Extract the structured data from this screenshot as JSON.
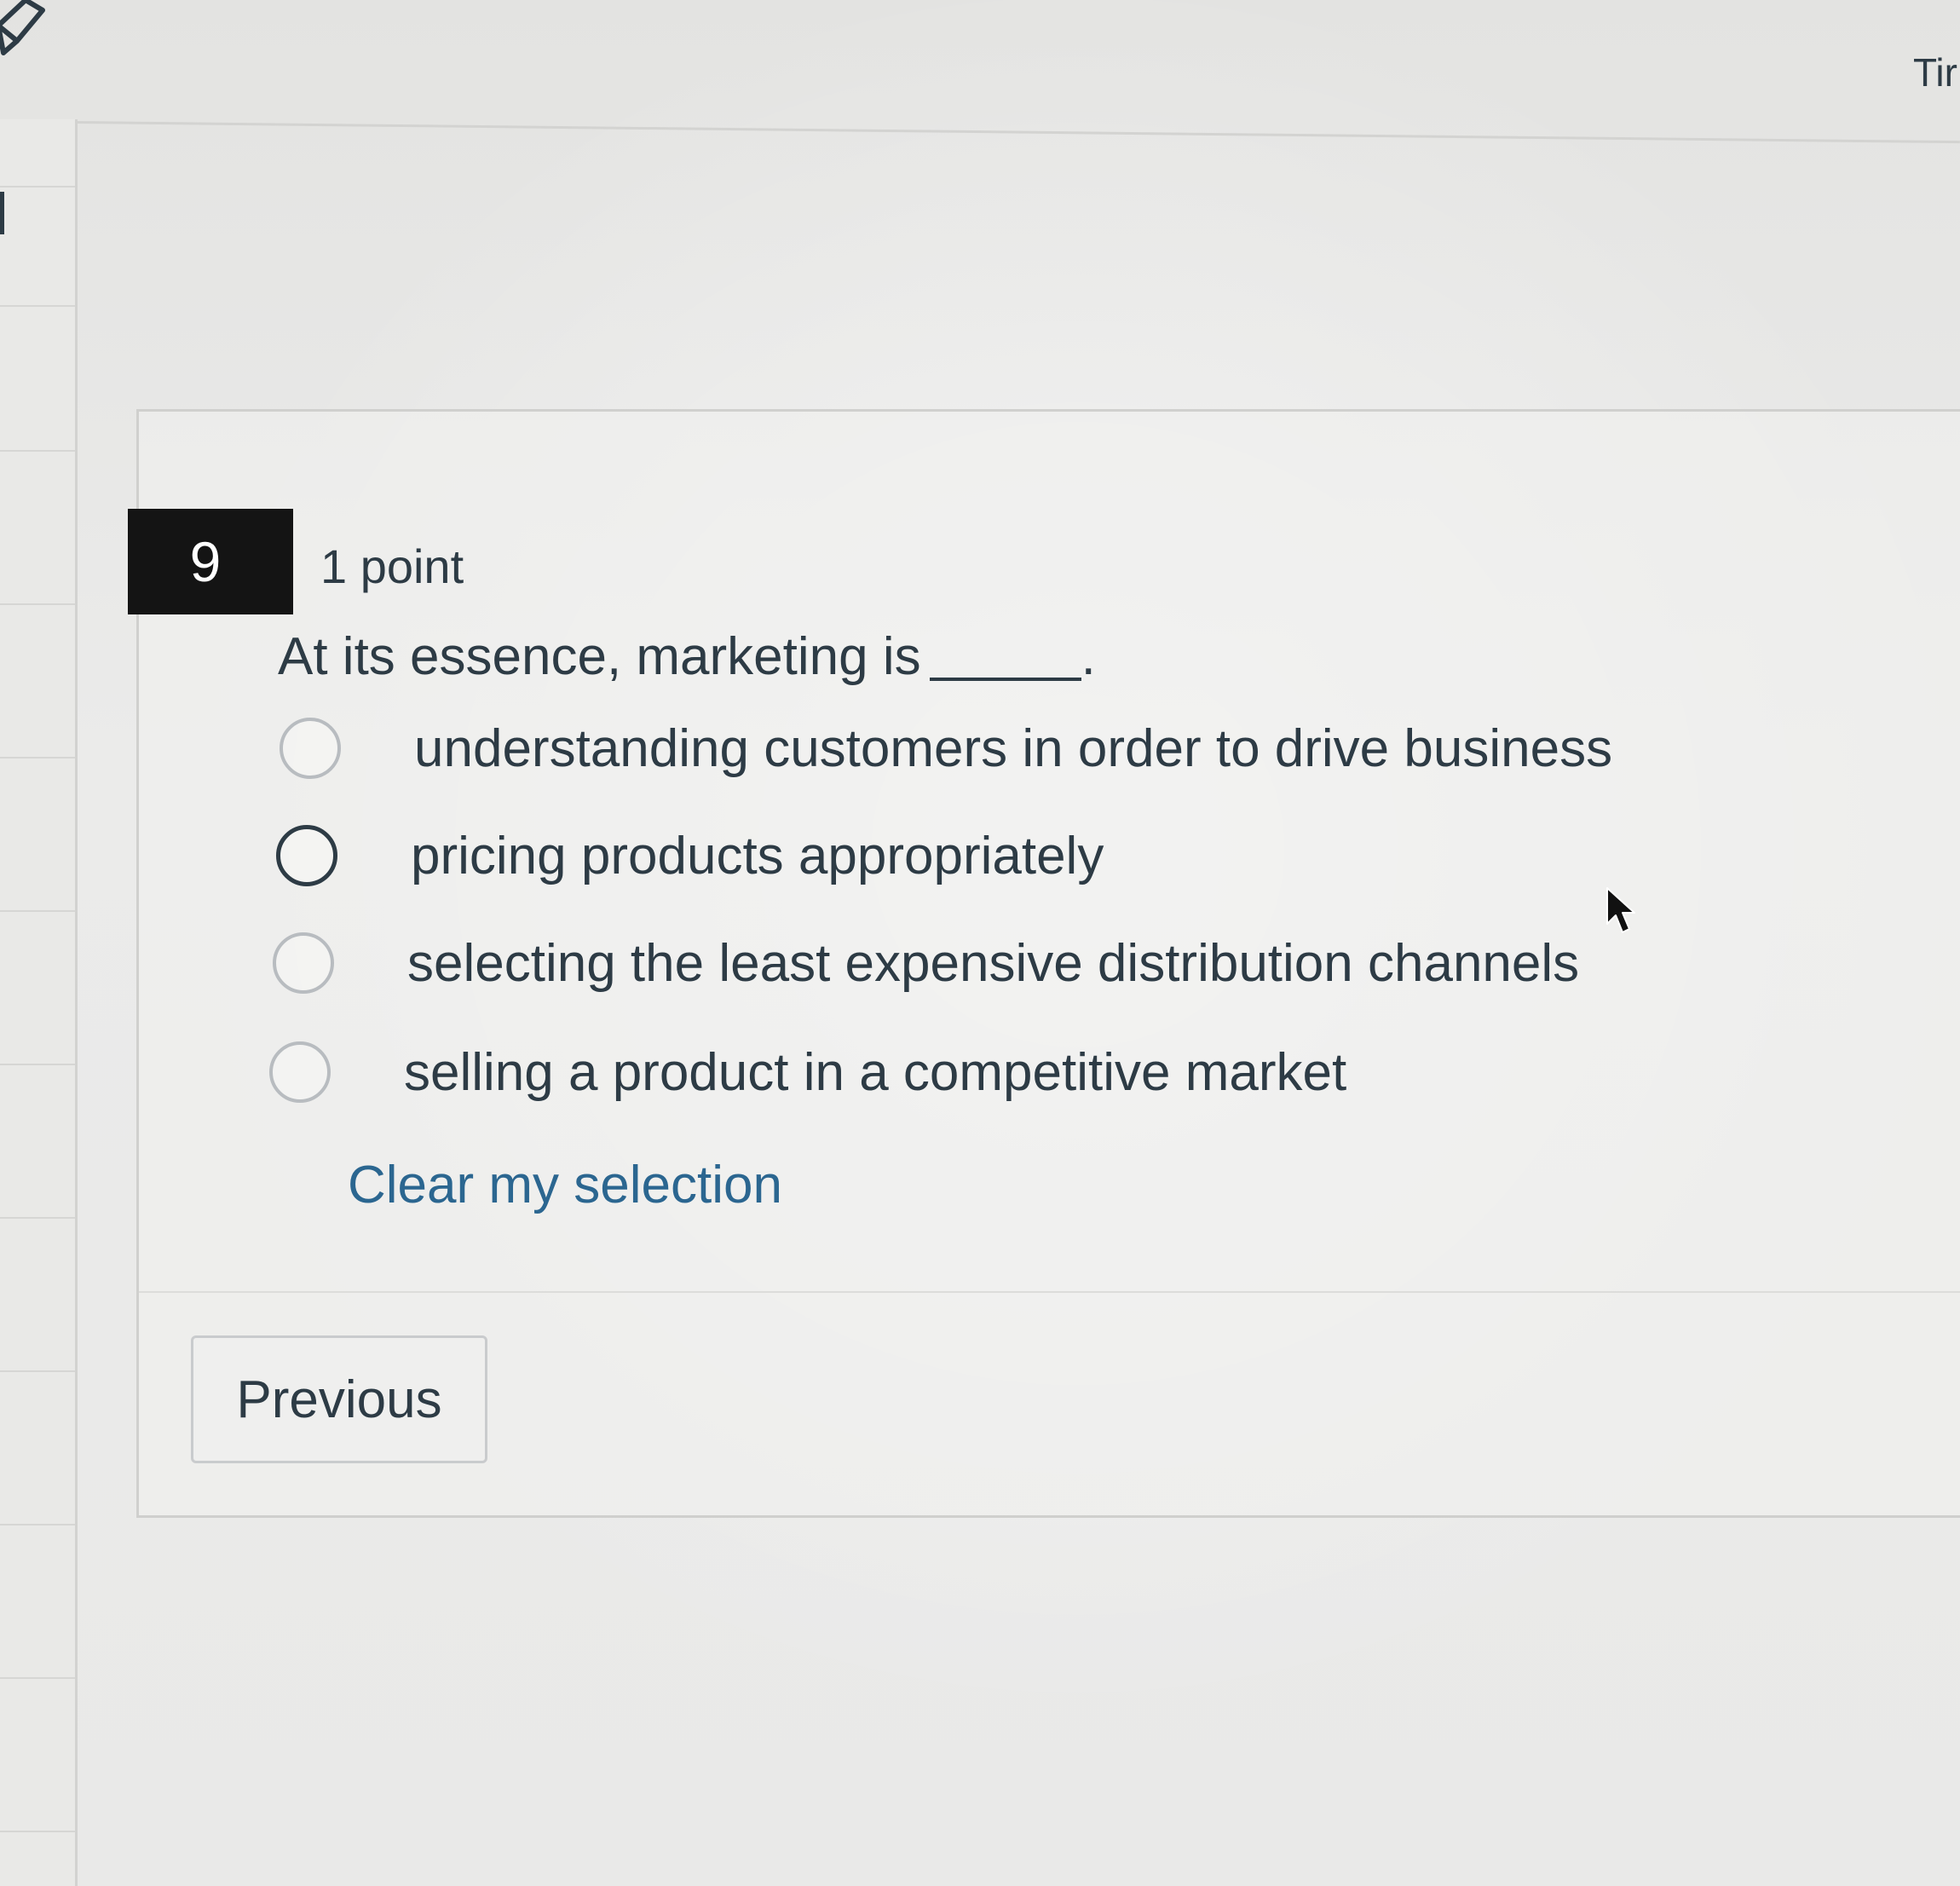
{
  "header": {
    "timer_label": "Tir"
  },
  "question": {
    "number": "9",
    "points": "1 point",
    "text": "At its essence, marketing is",
    "text_end": ".",
    "answers": [
      {
        "label": "understanding customers in order to drive business"
      },
      {
        "label": "pricing products appropriately"
      },
      {
        "label": "selecting the least expensive distribution channels"
      },
      {
        "label": "selling a product in a competitive market"
      }
    ],
    "clear_label": "Clear my selection"
  },
  "navigation": {
    "previous_label": "Previous"
  },
  "colors": {
    "text": "#2d3b45",
    "link": "#2b6690",
    "number_badge": "#141414"
  },
  "icons": [
    "pencil-icon",
    "radio-icon",
    "mouse-pointer-icon"
  ]
}
